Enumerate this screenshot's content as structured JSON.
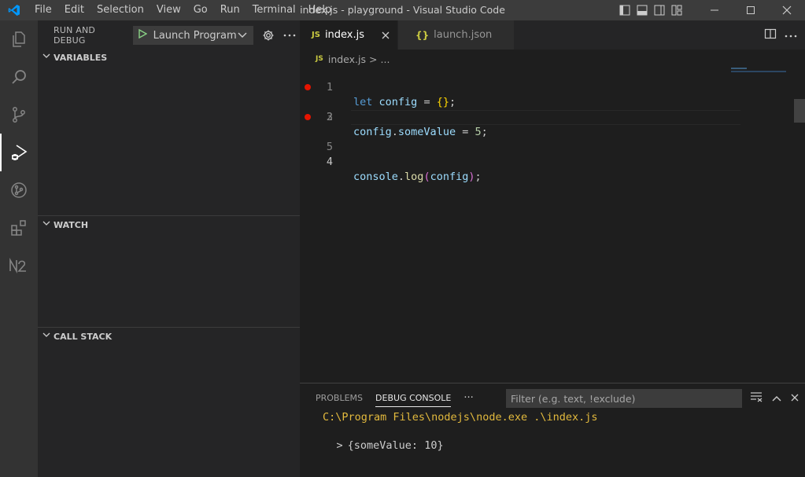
{
  "titlebar": {
    "menu": [
      "File",
      "Edit",
      "Selection",
      "View",
      "Go",
      "Run",
      "Terminal",
      "Help"
    ],
    "title": "index.js - playground - Visual Studio Code"
  },
  "activitybar": {
    "items": [
      "explorer-icon",
      "search-icon",
      "source-control-icon",
      "run-debug-icon",
      "git-graph-icon",
      "extensions-icon",
      "nx-console-icon"
    ],
    "active": "run-debug-icon"
  },
  "sidebar": {
    "title": "RUN AND DEBUG",
    "launch_config": "Launch Program",
    "sections": {
      "variables": "VARIABLES",
      "watch": "WATCH",
      "call_stack": "CALL STACK"
    }
  },
  "editor": {
    "tabs": [
      {
        "icon": "JS",
        "label": "index.js",
        "active": true
      },
      {
        "icon": "{}",
        "label": "launch.json",
        "active": false
      }
    ],
    "breadcrumb": {
      "icon": "JS",
      "file": "index.js",
      "separator": ">",
      "more": "..."
    },
    "lines": [
      {
        "n": "1",
        "breakpoint": false
      },
      {
        "n": "2",
        "breakpoint": true
      },
      {
        "n": "3",
        "breakpoint": false
      },
      {
        "n": "4",
        "breakpoint": true
      },
      {
        "n": "5",
        "breakpoint": false
      }
    ],
    "code": {
      "l1_kw": "let",
      "l1_var": "config",
      "l1_rest": " = ",
      "l1_braces": "{}",
      "l1_end": ";",
      "l2_obj": "config",
      "l2_dot": ".",
      "l2_prop": "someValue",
      "l2_eq": " = ",
      "l2_num": "5",
      "l2_end": ";",
      "l4_obj": "console",
      "l4_dot": ".",
      "l4_fn": "log",
      "l4_open": "(",
      "l4_arg": "config",
      "l4_close": ")",
      "l4_end": ";"
    }
  },
  "panel": {
    "tabs": [
      "PROBLEMS",
      "DEBUG CONSOLE"
    ],
    "active_tab": "DEBUG CONSOLE",
    "more": "···",
    "filter_placeholder": "Filter (e.g. text, !exclude)",
    "console": {
      "command": "C:\\Program Files\\nodejs\\node.exe .\\index.js",
      "output_chevron": ">",
      "output": "{someValue: 10}"
    }
  },
  "colors": {
    "accent": "#0078d4",
    "breakpoint": "#e51400",
    "command_text": "#e2b93d"
  }
}
